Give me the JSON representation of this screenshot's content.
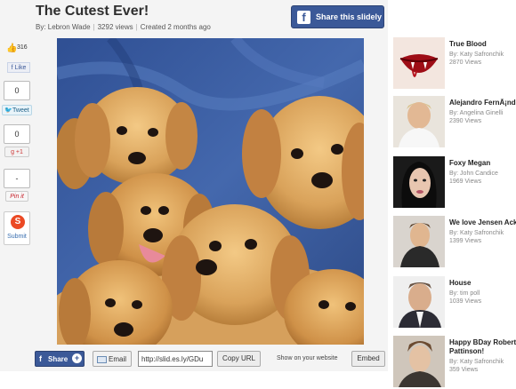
{
  "slideshow": {
    "title": "The Cutest Ever!",
    "author": "By: Lebron Wade",
    "views": "3292 views",
    "created": "Created 2 months ago"
  },
  "header": {
    "fb_share_label": "Share this slidely"
  },
  "social": {
    "fb_like_count": "316",
    "fb_like_label": "Like",
    "tweet_count": "0",
    "tweet_label": "Tweet",
    "gplus_count": "0",
    "gplus_label": "+1",
    "pin_count": "-",
    "pin_label": "Pin it",
    "stumble_label": "Submit"
  },
  "toolbar": {
    "share_label": "Share",
    "email_label": "Email",
    "url_value": "http://slid.es.ly/GDu",
    "copy_label": "Copy URL",
    "show_label": "Show on your website",
    "embed_label": "Embed"
  },
  "sidebar": {
    "items": [
      {
        "title": "True Blood",
        "author": "By: Katy Safronchik",
        "views": "2870 Views"
      },
      {
        "title": "Alejandro FernÃ¡ndez",
        "author": "By: Angelina Ginelli",
        "views": "2390 Views"
      },
      {
        "title": "Foxy Megan",
        "author": "By: John Candice",
        "views": "1969 Views"
      },
      {
        "title": "We love Jensen Ackles",
        "author": "By: Katy Safronchik",
        "views": "1399 Views"
      },
      {
        "title": "House",
        "author": "By: tim poll",
        "views": "1039 Views"
      },
      {
        "title": "Happy BDay Robert Pattinson!",
        "author": "By: Katy Safronchik",
        "views": "359 Views"
      }
    ]
  },
  "colors": {
    "facebook": "#3b5998",
    "page_bg": "#f4f4f4",
    "puppy": "#d9a25a",
    "fabric": "#3d5fa3"
  }
}
